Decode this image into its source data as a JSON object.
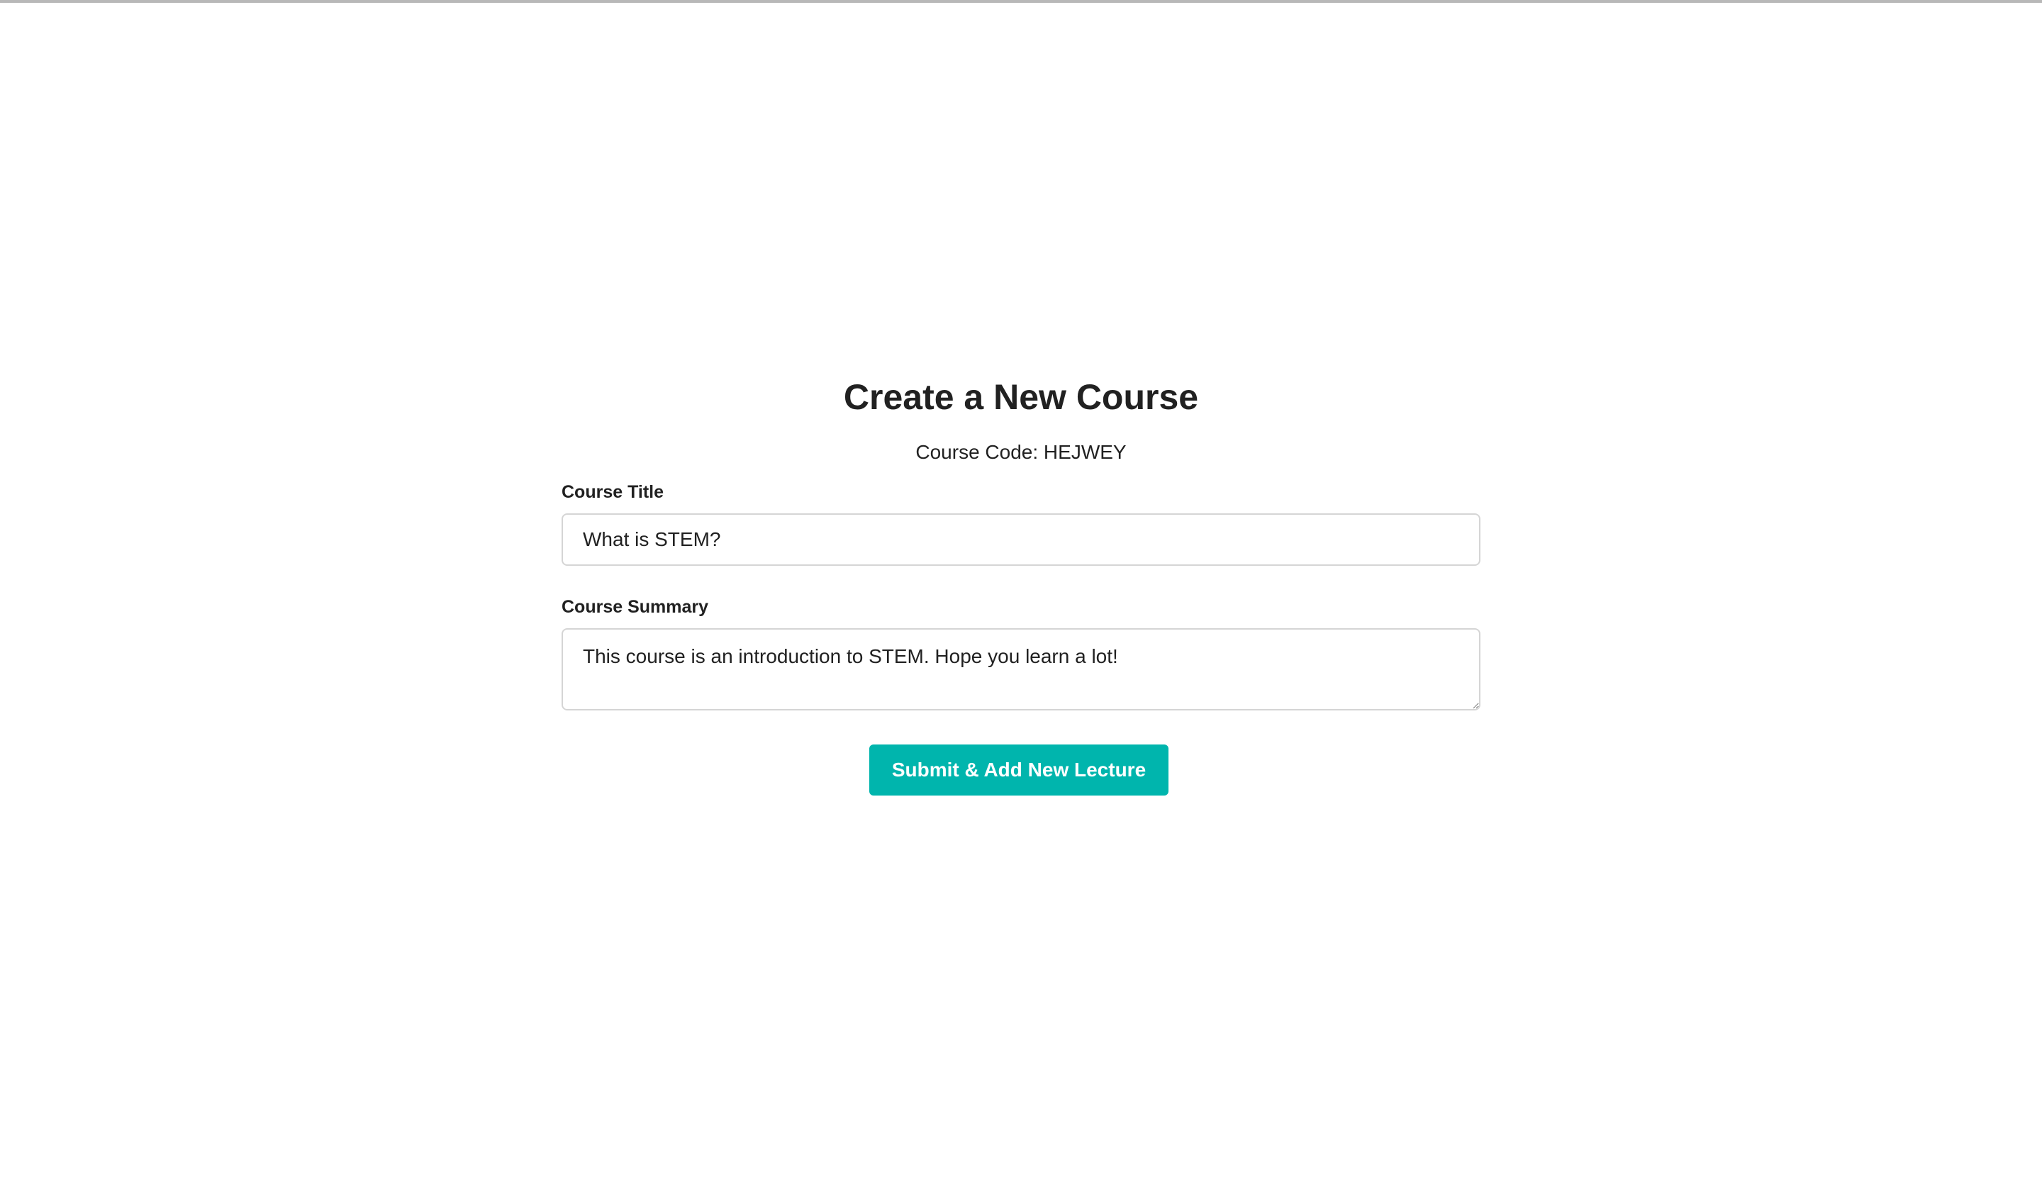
{
  "page": {
    "title": "Create a New Course",
    "course_code": "Course Code: HEJWEY"
  },
  "form": {
    "title_label": "Course Title",
    "title_value": "What is STEM?",
    "summary_label": "Course Summary",
    "summary_value": "This course is an introduction to STEM. Hope you learn a lot!",
    "submit_label": "Submit & Add New Lecture"
  },
  "colors": {
    "accent": "#00b5ad",
    "text": "#212121",
    "border": "#d5d5d5"
  }
}
